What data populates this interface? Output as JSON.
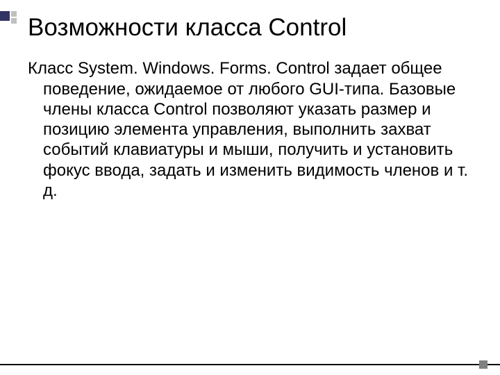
{
  "slide": {
    "title": "Возможности класса  Control",
    "body": "Класс System. Windows. Forms. Control задает общее поведение, ожидаемое от любого GUI-типа. Базовые члены класса Control позволяют указать размер и позицию элемента управления, выполнить захват событий клавиатуры и мыши, получить и установить фокус ввода, задать и изменить видимость членов и т. д."
  }
}
